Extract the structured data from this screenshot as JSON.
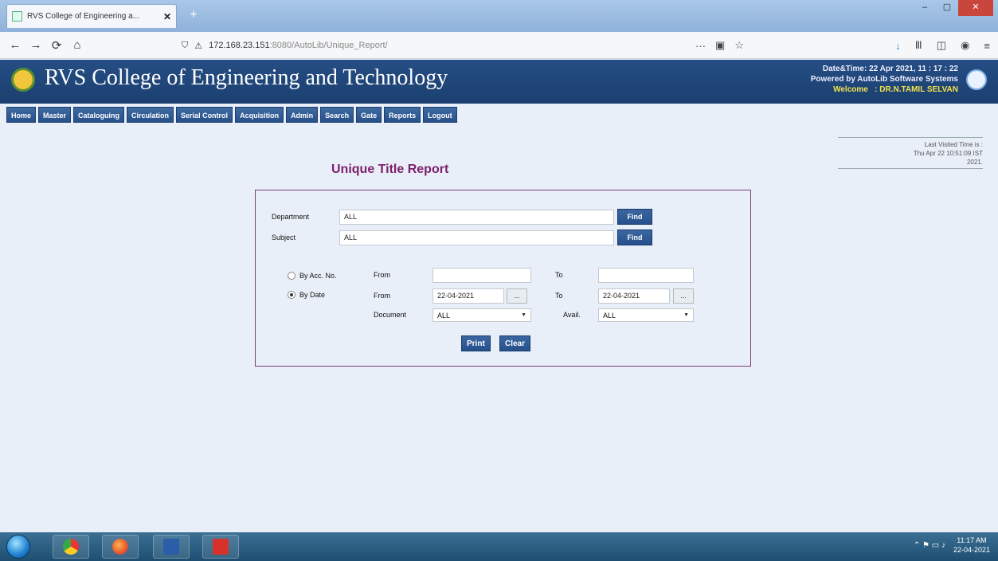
{
  "browser": {
    "tab_title": "RVS College of Engineering a...",
    "tab_close": "✕",
    "new_tab": "+",
    "url_host": "172.168.23.151",
    "url_path": ":8080/AutoLib/Unique_Report/",
    "back": "←",
    "forward": "→",
    "reload": "⟳",
    "home": "⌂",
    "url_more": "···",
    "pocket": "▣",
    "star": "☆",
    "downloads": "↓",
    "library": "Ⅲ",
    "sidebar": "◫",
    "account": "◉",
    "menu": "≡",
    "win_min": "‒",
    "win_max": "▢",
    "win_close": "✕"
  },
  "header": {
    "college_name": "RVS College of Engineering and Technology",
    "datetime_label": "Date&Time:",
    "datetime_value": "22 Apr 2021, 11 : 17 : 22",
    "powered_by": "Powered by AutoLib Software Systems",
    "welcome_label": "Welcome",
    "welcome_sep": ":",
    "welcome_user": "DR.N.TAMIL SELVAN"
  },
  "menu": {
    "items": [
      "Home",
      "Master",
      "Cataloguing",
      "Circulation",
      "Serial Control",
      "Acquisition",
      "Admin",
      "Search",
      "Gate",
      "Reports",
      "Logout"
    ]
  },
  "last_visited": {
    "label": "Last Visited Time is :",
    "value": "Thu Apr 22 10:51:09 IST",
    "year": "2021."
  },
  "report": {
    "title": "Unique Title Report",
    "department_label": "Department",
    "department_value": "ALL",
    "subject_label": "Subject",
    "subject_value": "ALL",
    "find_label": "Find",
    "by_acc_label": "By Acc. No.",
    "by_date_label": "By Date",
    "from_label": "From",
    "to_label": "To",
    "acc_from_value": "",
    "acc_to_value": "",
    "date_from_value": "22-04-2021",
    "date_to_value": "22-04-2021",
    "cal_label": "...",
    "document_label": "Document",
    "document_value": "ALL",
    "avail_label": "Avail.",
    "avail_value": "ALL",
    "print_label": "Print",
    "clear_label": "Clear"
  },
  "taskbar": {
    "time": "11:17 AM",
    "date": "22-04-2021",
    "tray_icons": "⌃ ⚑ ▭ ♪"
  }
}
